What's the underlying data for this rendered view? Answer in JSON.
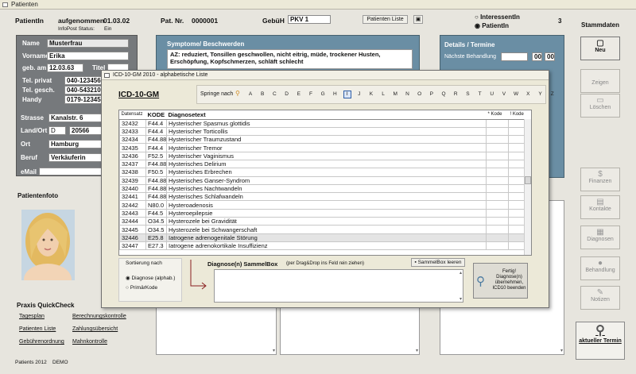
{
  "window": {
    "title": "Patienten"
  },
  "header": {
    "patient_label": "PatientIn",
    "aufgenommen_label": "aufgenommen",
    "aufgenommen_value": "01.03.02",
    "infopost_label": "InfoPost Status:",
    "infopost_value": "Ein",
    "patnr_label": "Pat. Nr.",
    "patnr_value": "0000001",
    "gebuehr_label": "GebüH",
    "gebuehr_value": "PKV 1",
    "patienten_liste_btn": "Patienten Liste",
    "radio_interessent": "InteressentIn",
    "radio_patient": "PatientIn",
    "count": "3"
  },
  "person": {
    "name_label": "Name",
    "name": "Musterfrau",
    "vorname_label": "Vorname",
    "vorname": "Erika",
    "geb_label": "geb. am",
    "geb": "12.03.63",
    "titel_label": "Titel",
    "tel_privat_label": "Tel. privat",
    "tel_privat": "040-123456",
    "tel_gesch_label": "Tel. gesch.",
    "tel_gesch": "040-543210",
    "handy_label": "Handy",
    "handy": "0179-12345",
    "strasse_label": "Strasse",
    "strasse": "Kanalstr. 6",
    "landort_label": "Land/Ort",
    "land": "D",
    "plz": "20566",
    "ort_label": "Ort",
    "ort": "Hamburg",
    "beruf_label": "Beruf",
    "beruf": "Verkäuferin",
    "email_label": "eMail"
  },
  "photo_label": "Patientenfoto",
  "quickcheck": {
    "title": "Praxis QuickCheck",
    "links": [
      "Tagesplan",
      "Berechnungskontrolle",
      "Patienten Liste",
      "Zahlungsübersicht",
      "Gebührenordnung",
      "Mahnkontrolle"
    ]
  },
  "footer": {
    "app": "Patients 2012",
    "mode": "DEMO"
  },
  "symptome": {
    "title": "Symptome/ Beschwerden",
    "text": "AZ: reduziert, Tonsillen geschwollen, nicht eitrig, müde, trockener Husten, Erschöpfung, Kopfschmerzen, schläft schlecht"
  },
  "details": {
    "title": "Details / Termine",
    "naechste_label": "Nächste Behandlung",
    "hh": "00",
    "mm": "00"
  },
  "sidebar": {
    "title": "Stammdaten",
    "neu": "Neu",
    "zeigen": "Zeigen",
    "loeschen": "Löschen",
    "finanzen": "Finanzen",
    "kontakte": "Kontakte",
    "diagnosen": "Diagnosen",
    "behandlung": "Behandlung",
    "notizen": "Notizen",
    "termin": "aktueller Termin"
  },
  "modal": {
    "title": "ICD-10-GM 2010 - alphabetische Liste",
    "heading": "ICD-10-GM",
    "springe_label": "Springe nach",
    "letters": [
      "A",
      "B",
      "C",
      "D",
      "E",
      "F",
      "G",
      "H",
      "I",
      "J",
      "K",
      "L",
      "M",
      "N",
      "O",
      "P",
      "Q",
      "R",
      "S",
      "T",
      "U",
      "V",
      "W",
      "X",
      "Y",
      "Z"
    ],
    "selected_letter": "I",
    "columns": {
      "datensatz": "Datensatz",
      "kode": "KODE",
      "text": "Diagnosetext",
      "stern": "* Kode",
      "kreuz": "! Kode"
    },
    "rows": [
      [
        "32432",
        "F44.4",
        "Hysterischer Spasmus glottidis"
      ],
      [
        "32433",
        "F44.4",
        "Hysterischer Torticollis"
      ],
      [
        "32434",
        "F44.88",
        "Hysterischer Traumzustand"
      ],
      [
        "32435",
        "F44.4",
        "Hysterischer Tremor"
      ],
      [
        "32436",
        "F52.5",
        "Hysterischer Vaginismus"
      ],
      [
        "32437",
        "F44.88",
        "Hysterisches Delirium"
      ],
      [
        "32438",
        "F50.5",
        "Hysterisches Erbrechen"
      ],
      [
        "32439",
        "F44.88",
        "Hysterisches Ganser-Syndrom"
      ],
      [
        "32440",
        "F44.88",
        "Hysterisches Nachtwandeln"
      ],
      [
        "32441",
        "F44.88",
        "Hysterisches Schlafwandeln"
      ],
      [
        "32442",
        "N80.0",
        "Hysteroadenosis"
      ],
      [
        "32443",
        "F44.5",
        "Hysteroepilepsie"
      ],
      [
        "32444",
        "O34.5",
        "Hysterozele bei Gravidität"
      ],
      [
        "32445",
        "O34.5",
        "Hysterozele bei Schwangerschaft"
      ],
      [
        "32446",
        "E25.8",
        "Iatrogene adrenogenitale Störung"
      ],
      [
        "32447",
        "E27.3",
        "Iatrogene adrenokortikale Insuffizienz"
      ]
    ],
    "selected_row": 14,
    "sort_label": "Sortierung nach",
    "sort_diag": "Diagnose (alphab.)",
    "sort_primaer": "PrimärKode",
    "sammel_title": "Diagnose(n) SammelBox",
    "sammel_hint": "(per Drag&Drop ins Feld rein ziehen)",
    "sammel_clear": "SammelBox leeren",
    "fertig": "Fertig! Diagnose(n) übernehmen, ICD10 beenden"
  },
  "colors": {
    "dark_panel": "#76797c",
    "blue_panel": "#6a8ea4"
  }
}
